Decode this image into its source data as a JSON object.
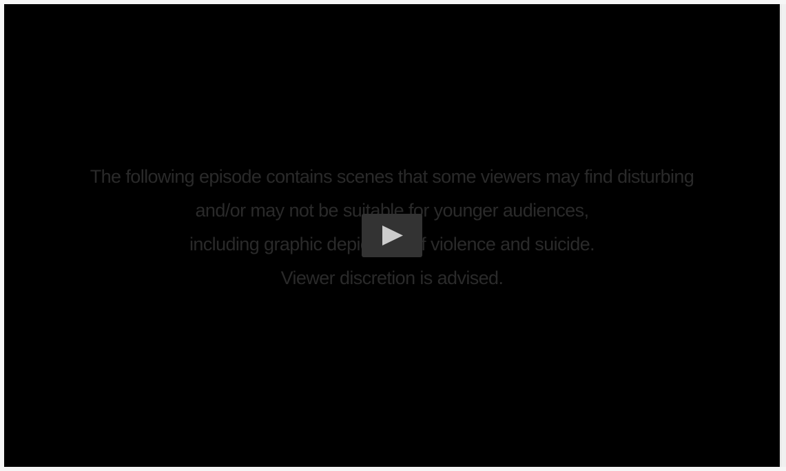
{
  "player": {
    "content_warning": {
      "lines": [
        "The following episode contains scenes that some viewers may find disturbing",
        "and/or may not be suitable for younger audiences,",
        "including graphic depictions of violence and suicide.",
        "Viewer discretion is advised."
      ]
    },
    "play_button": {
      "icon": "play-icon",
      "background_color": "#333333",
      "icon_color": "#cccccc"
    },
    "video_background_color": "#000000",
    "warning_text_color": "#2a2a2a"
  }
}
